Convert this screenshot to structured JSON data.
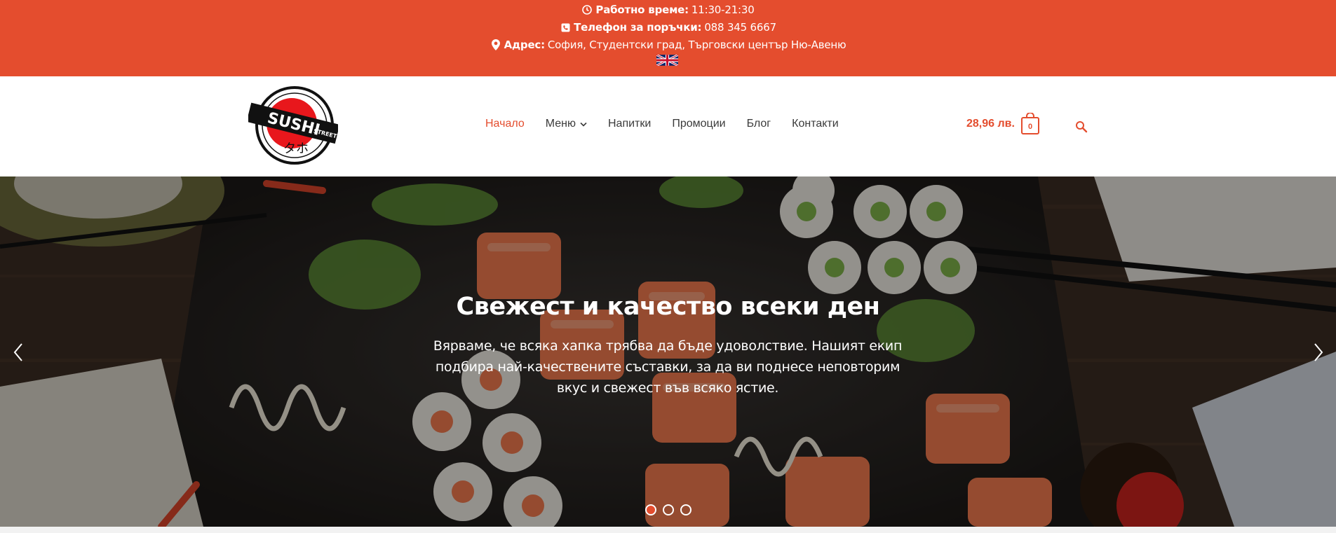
{
  "topbar": {
    "hours_label": "Работно време:",
    "hours_value": "11:30-21:30",
    "phone_label": "Телефон за поръчки:",
    "phone_value": "088 345 6667",
    "address_label": "Адрес:",
    "address_value": "София, Студентски град, Търговски център Ню-Авеню",
    "language_icon": "uk-flag-icon"
  },
  "header": {
    "logo_text": "SUSHI STREET",
    "nav": [
      {
        "label": "Начало",
        "active": true
      },
      {
        "label": "Меню",
        "has_dropdown": true
      },
      {
        "label": "Напитки"
      },
      {
        "label": "Промоции"
      },
      {
        "label": "Блог"
      },
      {
        "label": "Контакти"
      }
    ],
    "cart_total": "28,96 лв.",
    "cart_count": "0"
  },
  "hero": {
    "title": "Свежест и качество всеки ден",
    "text": "Вярваме, че всяка хапка трябва да бъде удоволствие. Нашият екип подбира най-качествените съставки, за да ви поднесе неповторим вкус и свежест във всяко ястие.",
    "slides": 3,
    "active_slide": 1
  },
  "colors": {
    "accent": "#e44d2e",
    "text": "#3a3a3a"
  }
}
